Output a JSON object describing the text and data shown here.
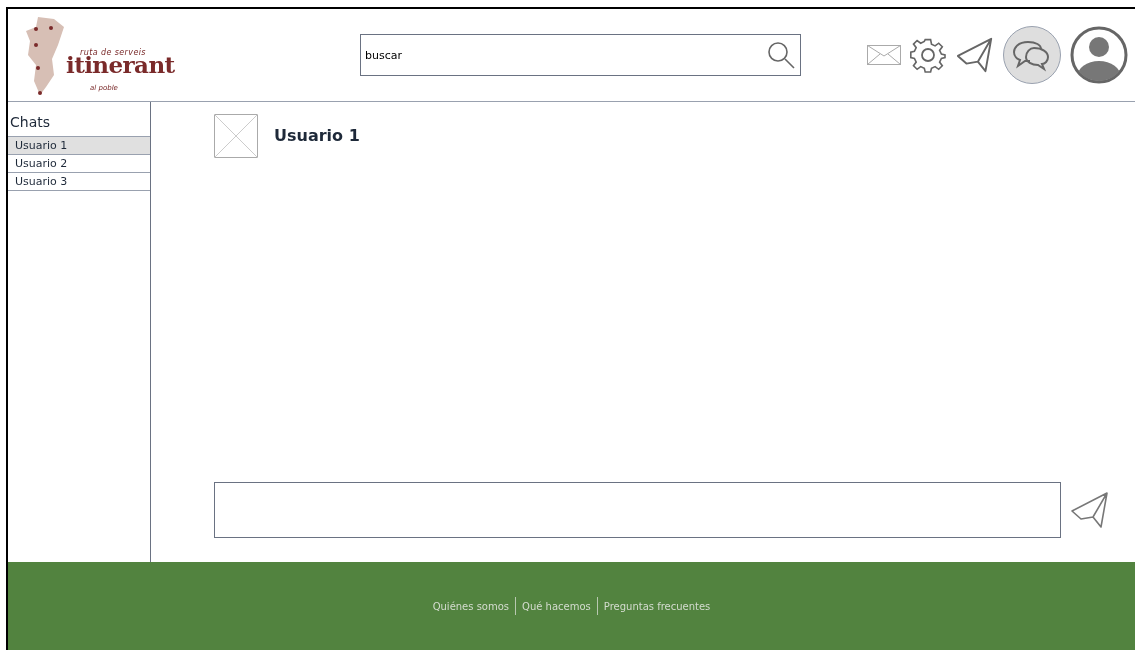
{
  "logo": {
    "top": "ruta de serveis",
    "name": "itinerant",
    "bottom": "al poble"
  },
  "search": {
    "value": "buscar"
  },
  "header_icons": [
    {
      "kind": "mail",
      "selected": false
    },
    {
      "kind": "gear",
      "selected": false
    },
    {
      "kind": "send",
      "selected": false
    },
    {
      "kind": "chat",
      "selected": true
    },
    {
      "kind": "user",
      "selected": false
    }
  ],
  "sidebar": {
    "title": "Chats",
    "items": [
      {
        "label": "Usuario 1",
        "selected": true
      },
      {
        "label": "Usuario 2",
        "selected": false
      },
      {
        "label": "Usuario 3",
        "selected": false
      }
    ]
  },
  "chat": {
    "title": "Usuario 1"
  },
  "footer": {
    "links": [
      "Quiénes somos",
      "Qué hacemos",
      "Preguntas frecuentes"
    ]
  }
}
